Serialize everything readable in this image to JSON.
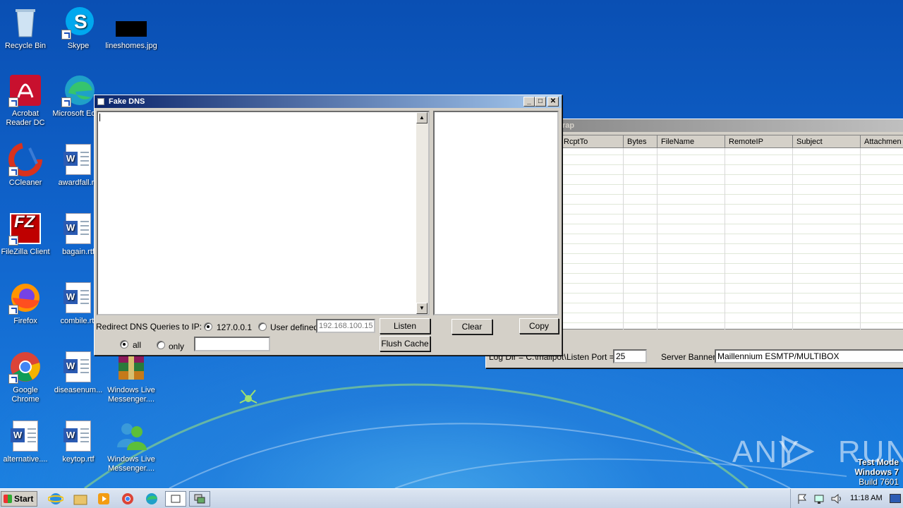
{
  "desktop": {
    "icons": [
      {
        "label": "Recycle Bin",
        "icon": "recycle-bin-icon"
      },
      {
        "label": "Skype",
        "icon": "skype-icon"
      },
      {
        "label": "lineshomes.jpg",
        "icon": "image-file-icon"
      },
      {
        "label": "Acrobat Reader DC",
        "icon": "acrobat-icon"
      },
      {
        "label": "Microsoft Edge",
        "icon": "edge-icon"
      },
      {
        "label": "CCleaner",
        "icon": "ccleaner-icon"
      },
      {
        "label": "awardfall.rtf",
        "icon": "word-doc-icon"
      },
      {
        "label": "FileZilla Client",
        "icon": "filezilla-icon"
      },
      {
        "label": "bagain.rtf",
        "icon": "word-doc-icon"
      },
      {
        "label": "Firefox",
        "icon": "firefox-icon"
      },
      {
        "label": "combile.rtf",
        "icon": "word-doc-icon"
      },
      {
        "label": "Google Chrome",
        "icon": "chrome-icon"
      },
      {
        "label": "diseasenum...",
        "icon": "word-doc-icon"
      },
      {
        "label": "Windows Live Messenger....",
        "icon": "winrar-icon"
      },
      {
        "label": "alternative....",
        "icon": "word-doc-icon"
      },
      {
        "label": "keytop.rtf",
        "icon": "word-doc-icon"
      },
      {
        "label": "Windows Live Messenger....",
        "icon": "messenger-icon"
      }
    ]
  },
  "mailpot": {
    "title": "rap",
    "columns": [
      "RcptTo",
      "Bytes",
      "FileName",
      "RemoteIP",
      "Subject",
      "Attachmen"
    ],
    "log_dir_label": "Log Dir = C:\\mailpot\\",
    "listen_port_label": "Listen Port =",
    "listen_port_value": "25",
    "server_banner_label": "Server Banner",
    "server_banner_value": "Maillennium ESMTP/MULTIBOX"
  },
  "fakedns": {
    "title": "Fake DNS",
    "redirect_label": "Redirect DNS Queries to IP:",
    "radio_localhost": "127.0.0.1",
    "radio_user_defined": "User defined",
    "user_ip_placeholder": "192.168.100.15",
    "listen_button": "Listen",
    "flush_cache_button": "Flush Cache",
    "clear_button": "Clear",
    "copy_button": "Copy",
    "radio_all": "all",
    "radio_only": "only",
    "only_value": ""
  },
  "taskbar": {
    "start_label": "Start",
    "clock": "11:18 AM"
  },
  "watermark": {
    "brand": "ANY RUN",
    "line1": "Test Mode",
    "line2": "Windows 7",
    "line3": "Build 7601"
  },
  "colors": {
    "title_active": "#0a246a",
    "desktop": "#1064cc"
  }
}
